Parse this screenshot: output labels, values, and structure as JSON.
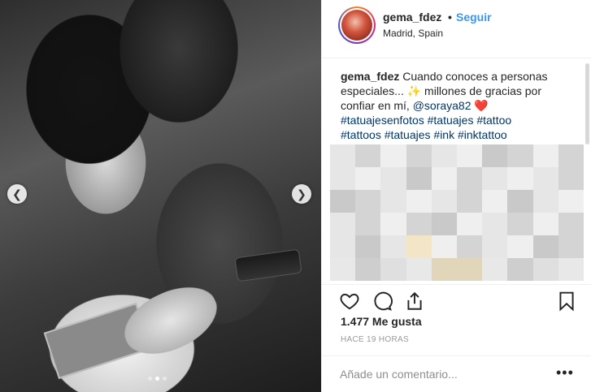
{
  "post": {
    "username": "gema_fdez",
    "separator": "•",
    "follow_label": "Seguir",
    "location": "Madrid, Spain"
  },
  "caption": {
    "username": "gema_fdez",
    "text_1": " Cuando conoces a personas especiales... ",
    "sparkle": "✨",
    "text_2": " millones de gracias por confiar en mí, ",
    "mention": "@soraya82",
    "heart": " ❤️",
    "hashtags_line1": "#tatuajesenfotos #tatuajes #tattoo",
    "hashtags_line2": "#tattoos #tatuajes #ink #inktattoo"
  },
  "carousel": {
    "prev": "❮",
    "next": "❯",
    "slides": 3,
    "active_slide": 2
  },
  "icons": [
    "heart-icon",
    "comment-icon",
    "share-icon",
    "bookmark-icon",
    "more-options-icon"
  ],
  "stats": {
    "likes": "1.477 Me gusta",
    "time": "HACE 19 HORAS"
  },
  "comment": {
    "placeholder": "Añade un comentario...",
    "more": "•••"
  },
  "colors": {
    "link": "#3897f0",
    "text": "#262626",
    "muted": "#999999"
  }
}
